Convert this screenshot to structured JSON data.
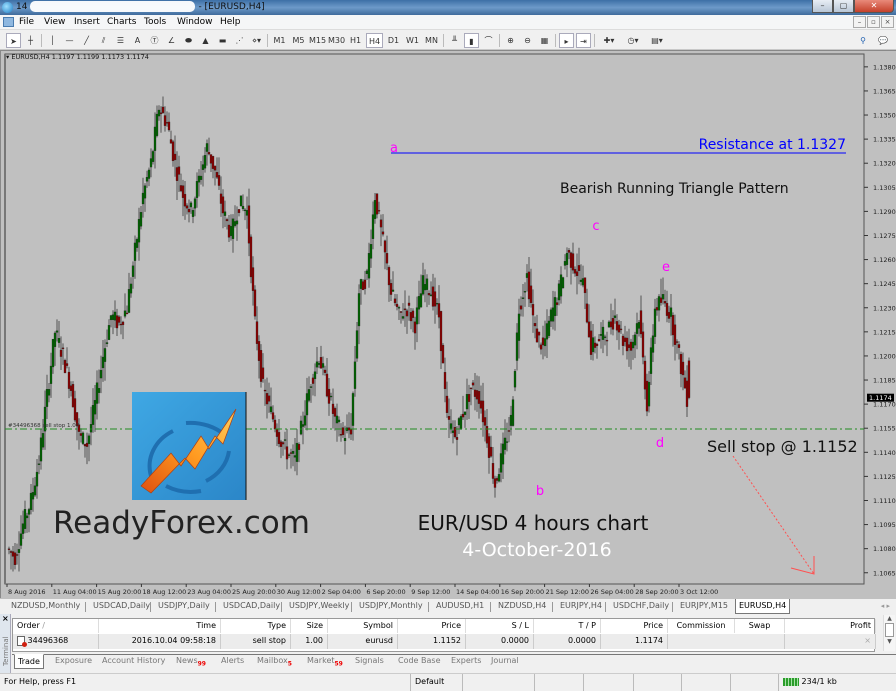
{
  "window": {
    "title_prefix": "14",
    "title_suffix": "- [EURUSD,H4]",
    "buttons": {
      "minimize": "–",
      "restore": "▢",
      "close": "✕"
    }
  },
  "menu": {
    "items": [
      "File",
      "View",
      "Insert",
      "Charts",
      "Tools",
      "Window",
      "Help"
    ],
    "mdi_buttons": [
      "–",
      "▫",
      "×"
    ]
  },
  "toolbar": {
    "drawing_tools": [
      {
        "name": "cursor-icon",
        "glyph": "➤"
      },
      {
        "name": "crosshair-icon",
        "glyph": "┼"
      },
      {
        "name": "vertical-line-icon",
        "glyph": "│"
      },
      {
        "name": "horizontal-line-icon",
        "glyph": "—"
      },
      {
        "name": "trendline-icon",
        "glyph": "╱"
      },
      {
        "name": "equidistant-channel-icon",
        "glyph": "⫽"
      },
      {
        "name": "fibonacci-icon",
        "glyph": "☰"
      },
      {
        "name": "text-icon",
        "glyph": "A"
      },
      {
        "name": "text-label-icon",
        "glyph": "Ⓣ"
      },
      {
        "name": "arrow-angle-icon",
        "glyph": "∠"
      },
      {
        "name": "ellipse-icon",
        "glyph": "⬬"
      },
      {
        "name": "triangle-icon",
        "glyph": "▲"
      },
      {
        "name": "rectangle-icon",
        "glyph": "▬"
      },
      {
        "name": "fibo-fan-icon",
        "glyph": "⋰"
      },
      {
        "name": "more-tools-icon",
        "glyph": "⋄▾"
      }
    ],
    "timeframes": [
      "M1",
      "M5",
      "M15",
      "M30",
      "H1",
      "H4",
      "D1",
      "W1",
      "MN"
    ],
    "active_timeframe": "H4",
    "chart_tools": [
      {
        "name": "bar-chart-icon",
        "glyph": "╨"
      },
      {
        "name": "candlestick-icon",
        "glyph": "▮"
      },
      {
        "name": "line-chart-icon",
        "glyph": "⌒"
      },
      {
        "name": "zoom-in-icon",
        "glyph": "⊕"
      },
      {
        "name": "zoom-out-icon",
        "glyph": "⊖"
      },
      {
        "name": "tile-windows-icon",
        "glyph": "▦"
      },
      {
        "name": "auto-scroll-icon",
        "glyph": "▸"
      },
      {
        "name": "chart-shift-icon",
        "glyph": "⇥"
      },
      {
        "name": "indicators-icon",
        "glyph": "✚▾"
      },
      {
        "name": "periods-icon",
        "glyph": "◷▾"
      },
      {
        "name": "templates-icon",
        "glyph": "▤▾"
      }
    ],
    "right_tools": [
      {
        "name": "search-icon",
        "glyph": "⚲"
      },
      {
        "name": "chat-icon",
        "glyph": "💬"
      }
    ]
  },
  "chart": {
    "info_line": "EURUSD,H4  1.1197 1.1199 1.1173 1.1174",
    "order_line_label": "#34496368 sell stop 1.00",
    "annotations": {
      "resistance": "Resistance at 1.1327",
      "pattern": "Bearish Running Triangle Pattern",
      "sell_stop": "Sell stop @ 1.1152",
      "brand": "ReadyForex.com",
      "chart_title": "EUR/USD 4 hours chart",
      "date": "4-October-2016",
      "points": [
        "a",
        "b",
        "c",
        "d",
        "e"
      ]
    },
    "colors": {
      "background": "#c0c0c0",
      "bull": "#006400",
      "bear": "#8b0000",
      "wick": "#303030",
      "resistance": "#0000ff",
      "point_label": "#ff00ff",
      "order_line": "#228b22",
      "arrow": "#ff5050",
      "date_text": "#ffffff"
    }
  },
  "chart_data": {
    "type": "candlestick",
    "symbol": "EURUSD",
    "timeframe": "H4",
    "current_price": 1.1174,
    "ylim": [
      1.1058,
      1.1388
    ],
    "y_ticks": [
      1.138,
      1.1365,
      1.135,
      1.1335,
      1.132,
      1.1305,
      1.129,
      1.1275,
      1.126,
      1.1245,
      1.123,
      1.1215,
      1.12,
      1.1185,
      1.117,
      1.1155,
      1.114,
      1.1125,
      1.111,
      1.1095,
      1.108,
      1.1065
    ],
    "x_ticks": [
      "8 Aug 2016",
      "11 Aug 04:00",
      "15 Aug 20:00",
      "18 Aug 12:00",
      "23 Aug 04:00",
      "25 Aug 20:00",
      "30 Aug 12:00",
      "2 Sep 04:00",
      "6 Sep 20:00",
      "9 Sep 12:00",
      "14 Sep 04:00",
      "16 Sep 20:00",
      "21 Sep 12:00",
      "26 Sep 04:00",
      "28 Sep 20:00",
      "3 Oct 12:00"
    ],
    "levels": [
      {
        "name": "resistance",
        "price": 1.1327
      },
      {
        "name": "sell_stop",
        "price": 1.1152
      }
    ],
    "pattern_points": [
      {
        "label": "a",
        "price": 1.1327,
        "x_index": 0.455
      },
      {
        "label": "b",
        "price": 1.112,
        "x_index": 0.625
      },
      {
        "label": "c",
        "price": 1.1275,
        "x_index": 0.69
      },
      {
        "label": "d",
        "price": 1.1152,
        "x_index": 0.765
      },
      {
        "label": "e",
        "price": 1.1256,
        "x_index": 0.773
      }
    ],
    "path_closes": [
      1.108,
      1.1075,
      1.1095,
      1.111,
      1.1135,
      1.1175,
      1.1215,
      1.12,
      1.118,
      1.115,
      1.1145,
      1.117,
      1.12,
      1.1225,
      1.122,
      1.123,
      1.1265,
      1.13,
      1.132,
      1.1355,
      1.1345,
      1.132,
      1.13,
      1.129,
      1.131,
      1.133,
      1.1315,
      1.129,
      1.1275,
      1.1295,
      1.129,
      1.122,
      1.118,
      1.1165,
      1.115,
      1.114,
      1.1135,
      1.116,
      1.1185,
      1.12,
      1.118,
      1.116,
      1.115,
      1.1155,
      1.124,
      1.125,
      1.13,
      1.127,
      1.124,
      1.1225,
      1.123,
      1.122,
      1.1245,
      1.124,
      1.1225,
      1.116,
      1.115,
      1.1165,
      1.118,
      1.1175,
      1.115,
      1.112,
      1.114,
      1.116,
      1.123,
      1.125,
      1.1215,
      1.1205,
      1.1225,
      1.124,
      1.1265,
      1.1255,
      1.1245,
      1.1205,
      1.121,
      1.1215,
      1.1225,
      1.121,
      1.1205,
      1.1225,
      1.117,
      1.123,
      1.1235,
      1.1225,
      1.12,
      1.1174
    ]
  },
  "symbol_tabs": [
    "NZDUSD,Monthly",
    "USDCAD,Daily",
    "USDJPY,Daily",
    "USDCAD,Daily",
    "USDJPY,Weekly",
    "USDJPY,Monthly",
    "AUDUSD,H1",
    "NZDUSD,H4",
    "EURJPY,H4",
    "USDCHF,Daily",
    "EURJPY,M15",
    "EURUSD,H4"
  ],
  "active_symbol_tab": "EURUSD,H4",
  "terminal": {
    "side_label": "Terminal",
    "close": "×",
    "columns": [
      "Order",
      "Time",
      "Type",
      "Size",
      "Symbol",
      "Price",
      "S / L",
      "T / P",
      "Price",
      "Commission",
      "Swap",
      "Profit"
    ],
    "sort_indicator": "/",
    "rows": [
      {
        "order": "34496368",
        "time": "2016.10.04 09:58:18",
        "type": "sell stop",
        "size": "1.00",
        "symbol": "eurusd",
        "price": "1.1152",
        "sl": "0.0000",
        "tp": "0.0000",
        "cur_price": "1.1174",
        "commission": "",
        "swap": "",
        "profit": "×"
      }
    ],
    "tabs": [
      {
        "label": "Trade",
        "badge": ""
      },
      {
        "label": "Exposure",
        "badge": ""
      },
      {
        "label": "Account History",
        "badge": ""
      },
      {
        "label": "News",
        "badge": "99"
      },
      {
        "label": "Alerts",
        "badge": ""
      },
      {
        "label": "Mailbox",
        "badge": "5"
      },
      {
        "label": "Market",
        "badge": "59"
      },
      {
        "label": "Signals",
        "badge": ""
      },
      {
        "label": "Code Base",
        "badge": ""
      },
      {
        "label": "Experts",
        "badge": ""
      },
      {
        "label": "Journal",
        "badge": ""
      }
    ],
    "active_tab": "Trade"
  },
  "status": {
    "help": "For Help, press F1",
    "profile": "Default",
    "connection": "234/1 kb"
  }
}
